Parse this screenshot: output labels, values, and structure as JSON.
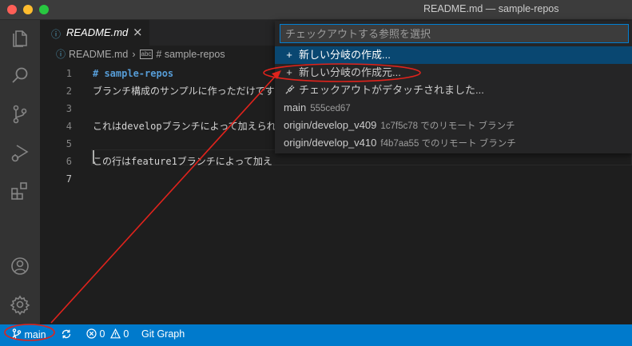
{
  "window": {
    "title": "README.md — sample-repos"
  },
  "tab": {
    "icon": "ⓘ",
    "label": "README.md",
    "close": "×"
  },
  "breadcrumb": {
    "file_icon": "ⓘ",
    "file": "README.md",
    "separator": "›",
    "md_icon": "abc",
    "section": "# sample-repos"
  },
  "editor": {
    "line_numbers": [
      "1",
      "2",
      "3",
      "4",
      "5",
      "6",
      "7"
    ],
    "lines": [
      "# sample-repos",
      "ブランチ構成のサンプルに作っただけです",
      "",
      "これはdevelopブランチによって加えられ",
      "",
      "この行はfeature1ブランチによって加え",
      ""
    ]
  },
  "quickpick": {
    "placeholder": "チェックアウトする参照を選択",
    "items": [
      {
        "icon": "plus-icon",
        "glyph": "+",
        "label": "新しい分岐の作成...",
        "desc": ""
      },
      {
        "icon": "plus-icon",
        "glyph": "+",
        "label": "新しい分岐の作成元...",
        "desc": ""
      },
      {
        "icon": "debug-disconnect-icon",
        "glyph": "⚲",
        "label": "チェックアウトがデタッチされました...",
        "desc": ""
      },
      {
        "icon": "",
        "glyph": "",
        "label": "main",
        "desc": "555ced67"
      },
      {
        "icon": "",
        "glyph": "",
        "label": "origin/develop_v409",
        "desc": "1c7f5c78 でのリモート ブランチ"
      },
      {
        "icon": "",
        "glyph": "",
        "label": "origin/develop_v410",
        "desc": "f4b7aa55 でのリモート ブランチ"
      }
    ]
  },
  "statusbar": {
    "branch": "main",
    "errors": "0",
    "warnings": "0",
    "git_graph": "Git Graph"
  },
  "colors": {
    "accent": "#007acc",
    "selection": "#094771",
    "annotation": "#e0231c"
  }
}
